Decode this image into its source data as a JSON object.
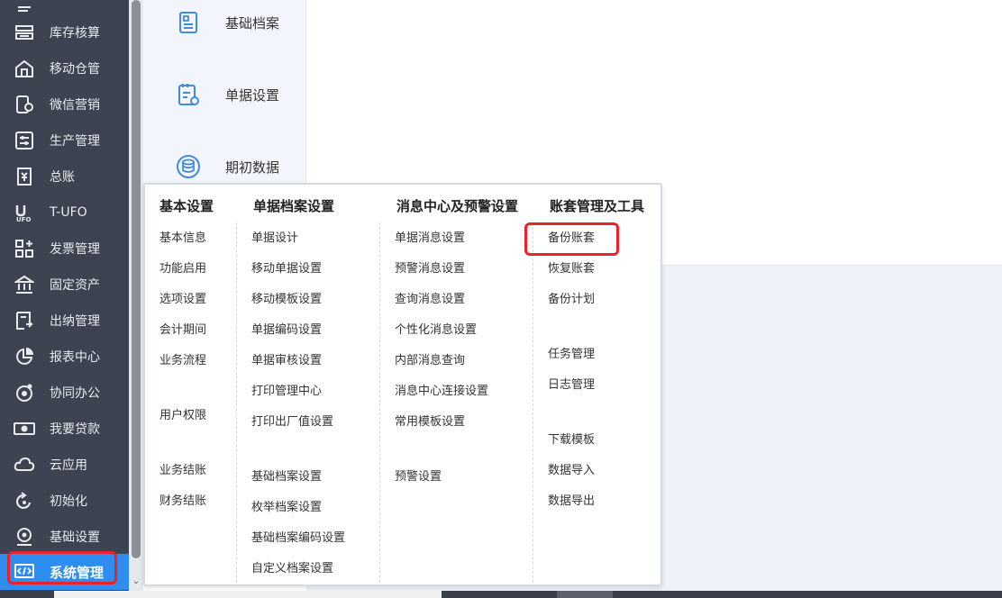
{
  "sidebar": {
    "items": [
      {
        "label": "库存核算",
        "icon": "inventory-icon"
      },
      {
        "label": "移动仓管",
        "icon": "mobile-warehouse-icon"
      },
      {
        "label": "微信营销",
        "icon": "wechat-marketing-icon"
      },
      {
        "label": "生产管理",
        "icon": "production-icon"
      },
      {
        "label": "总账",
        "icon": "ledger-icon"
      },
      {
        "label": "T-UFO",
        "icon": "ufo-icon"
      },
      {
        "label": "发票管理",
        "icon": "invoice-icon"
      },
      {
        "label": "固定资产",
        "icon": "bank-icon"
      },
      {
        "label": "出纳管理",
        "icon": "cashier-icon"
      },
      {
        "label": "报表中心",
        "icon": "pie-chart-icon"
      },
      {
        "label": "协同办公",
        "icon": "collaboration-icon"
      },
      {
        "label": "我要贷款",
        "icon": "cash-icon"
      },
      {
        "label": "云应用",
        "icon": "cloud-icon"
      },
      {
        "label": "初始化",
        "icon": "refresh-icon"
      },
      {
        "label": "基础设置",
        "icon": "settings-icon"
      },
      {
        "label": "系统管理",
        "icon": "code-icon"
      }
    ]
  },
  "upper_panel": {
    "items": [
      {
        "label": "基础档案",
        "icon": "document-icon"
      },
      {
        "label": "单据设置",
        "icon": "form-settings-icon"
      },
      {
        "label": "期初数据",
        "icon": "database-icon"
      }
    ]
  },
  "popup": {
    "columns": [
      {
        "title": "基本设置",
        "items": [
          "基本信息",
          "功能启用",
          "选项设置",
          "会计期间",
          "业务流程",
          "用户权限",
          "业务结账",
          "财务结账"
        ]
      },
      {
        "title": "单据档案设置",
        "items": [
          "单据设计",
          "移动单据设置",
          "移动模板设置",
          "单据编码设置",
          "单据审核设置",
          "打印管理中心",
          "打印出厂值设置",
          "基础档案设置",
          "枚举档案设置",
          "基础档案编码设置",
          "自定义档案设置"
        ]
      },
      {
        "title": "消息中心及预警设置",
        "items": [
          "单据消息设置",
          "预警消息设置",
          "查询消息设置",
          "个性化消息设置",
          "内部消息查询",
          "消息中心连接设置",
          "常用模板设置",
          "预警设置"
        ]
      },
      {
        "title": "账套管理及工具",
        "items": [
          "备份账套",
          "恢复账套",
          "备份计划",
          "任务管理",
          "日志管理",
          "下载模板",
          "数据导入",
          "数据导出"
        ]
      }
    ]
  },
  "colors": {
    "sidebar_bg": "#3d4350",
    "active_bg": "#2f8df0",
    "highlight": "#e8232a",
    "icon_blue": "#3f8be0"
  }
}
